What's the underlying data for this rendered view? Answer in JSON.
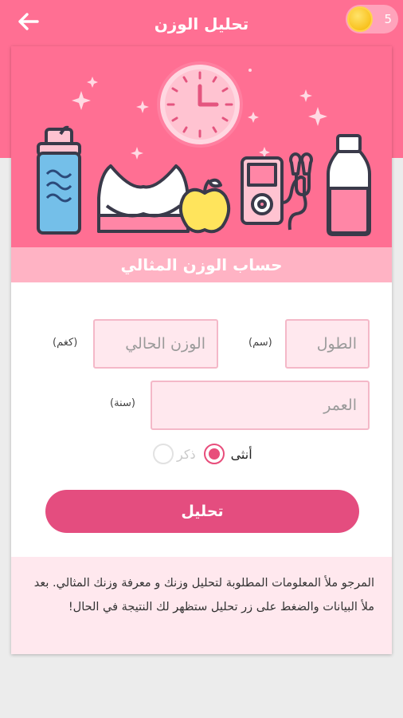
{
  "header": {
    "title": "تحليل الوزن",
    "coins": "5"
  },
  "form": {
    "section_title": "حساب الوزن المثالي",
    "height_placeholder": "الطول",
    "height_unit": "(سم)",
    "weight_placeholder": "الوزن الحالي",
    "weight_unit": "(كغم)",
    "age_placeholder": "العمر",
    "age_unit": "(سنة)",
    "gender_female": "أنثى",
    "gender_male": "ذكر",
    "selected_gender": "female",
    "analyze_label": "تحليل"
  },
  "info": {
    "text": "المرجو ملأ المعلومات المطلوبة لتحليل وزنك و معرفة وزنك المثالي. بعد ملأ البيانات والضغط على زر تحليل ستظهر لك النتيجة في الحال!"
  },
  "colors": {
    "primary": "#ff6f93",
    "button": "#e44d7f",
    "input_bg": "#ffe8ee",
    "accent": "#e84d7b"
  },
  "icons": [
    "back-arrow-icon",
    "coin-icon",
    "clock-icon",
    "water-bottle-icon",
    "sports-bra-icon",
    "apple-icon",
    "music-player-icon",
    "milk-bottle-icon"
  ]
}
